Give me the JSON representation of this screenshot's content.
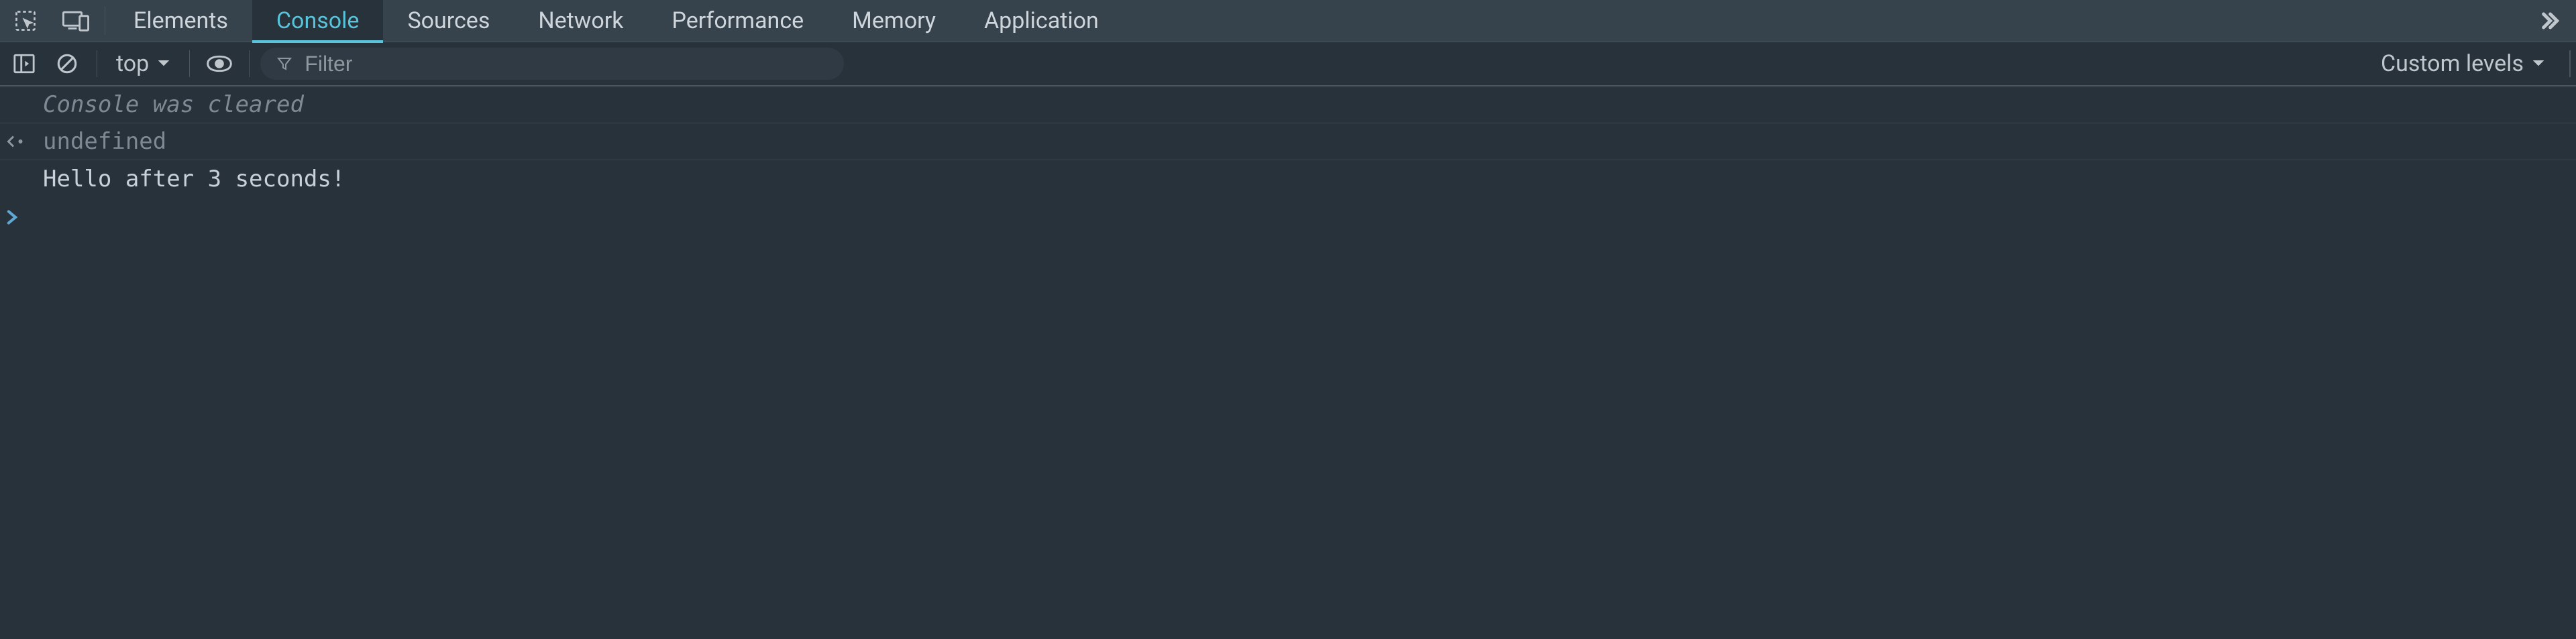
{
  "tabs": {
    "items": [
      {
        "label": "Elements",
        "active": false
      },
      {
        "label": "Console",
        "active": true
      },
      {
        "label": "Sources",
        "active": false
      },
      {
        "label": "Network",
        "active": false
      },
      {
        "label": "Performance",
        "active": false
      },
      {
        "label": "Memory",
        "active": false
      },
      {
        "label": "Application",
        "active": false
      }
    ]
  },
  "toolbar": {
    "context_label": "top",
    "filter_placeholder": "Filter",
    "filter_value": "",
    "levels_label": "Custom levels"
  },
  "console": {
    "cleared_msg": "Console was cleared",
    "return_value": "undefined",
    "log_msg": "Hello after 3 seconds!"
  }
}
